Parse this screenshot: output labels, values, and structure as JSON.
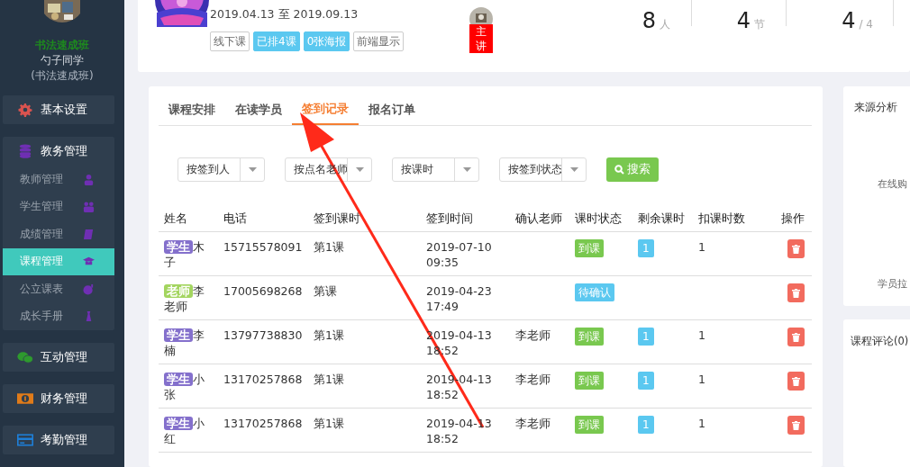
{
  "sidebar": {
    "class_name": "书法速成班",
    "user_name": "勺子同学",
    "user_class": "(书法速成班)",
    "menus": [
      {
        "label": "基本设置"
      },
      {
        "label": "教务管理",
        "children": [
          {
            "label": "教师管理",
            "selected": false
          },
          {
            "label": "学生管理",
            "selected": false
          },
          {
            "label": "成绩管理",
            "selected": false
          },
          {
            "label": "课程管理",
            "selected": true
          },
          {
            "label": "公立课表",
            "selected": false
          },
          {
            "label": "成长手册",
            "selected": false
          }
        ]
      },
      {
        "label": "互动管理"
      },
      {
        "label": "财务管理"
      },
      {
        "label": "考勤管理"
      }
    ]
  },
  "course": {
    "dates": "2019.04.13 至 2019.09.13",
    "tags": [
      {
        "label": "线下课",
        "kind": "outline"
      },
      {
        "label": "已排4课",
        "kind": "filled"
      },
      {
        "label": "0张海报",
        "kind": "filled"
      },
      {
        "label": "前端显示",
        "kind": "outline"
      }
    ],
    "teacher_badge": "主讲",
    "stats": [
      {
        "value": "8",
        "unit": "人"
      },
      {
        "value": "4",
        "unit": "节"
      },
      {
        "value": "4",
        "unit": "/ 4"
      }
    ]
  },
  "tabs": [
    {
      "label": "课程安排",
      "selected": false
    },
    {
      "label": "在读学员",
      "selected": false
    },
    {
      "label": "签到记录",
      "selected": true
    },
    {
      "label": "报名订单",
      "selected": false
    }
  ],
  "filters": [
    "按签到人",
    "按点名老师",
    "按课时",
    "按签到状态"
  ],
  "search_button": "搜索",
  "table": {
    "columns": [
      "姓名",
      "电话",
      "签到课时",
      "签到时间",
      "确认老师",
      "课时状态",
      "剩余课时",
      "扣课时数",
      "操作"
    ],
    "rows": [
      {
        "tag": {
          "kind": "student",
          "label": "学生"
        },
        "name": "木子",
        "phone": "15715578091",
        "lesson": "第1课",
        "date": "2019-07-10",
        "time": "09:35",
        "teacher": "",
        "status": {
          "kind": "arrived",
          "label": "到课"
        },
        "remaining": "1",
        "deduct": "1"
      },
      {
        "tag": {
          "kind": "teacher",
          "label": "老师"
        },
        "name": "李老师",
        "phone": "17005698268",
        "lesson": "第课",
        "date": "2019-04-23",
        "time": "17:49",
        "teacher": "",
        "status": {
          "kind": "pending",
          "label": "待确认"
        },
        "remaining": "",
        "deduct": ""
      },
      {
        "tag": {
          "kind": "student",
          "label": "学生"
        },
        "name": "李楠",
        "phone": "13797738830",
        "lesson": "第1课",
        "date": "2019-04-13",
        "time": "18:52",
        "teacher": "李老师",
        "status": {
          "kind": "arrived",
          "label": "到课"
        },
        "remaining": "1",
        "deduct": "1"
      },
      {
        "tag": {
          "kind": "student",
          "label": "学生"
        },
        "name": "小张",
        "phone": "13170257868",
        "lesson": "第1课",
        "date": "2019-04-13",
        "time": "18:52",
        "teacher": "李老师",
        "status": {
          "kind": "arrived",
          "label": "到课"
        },
        "remaining": "1",
        "deduct": "1"
      },
      {
        "tag": {
          "kind": "student",
          "label": "学生"
        },
        "name": "小红",
        "phone": "13170257868",
        "lesson": "第1课",
        "date": "2019-04-13",
        "time": "18:52",
        "teacher": "李老师",
        "status": {
          "kind": "arrived",
          "label": "到课"
        },
        "remaining": "1",
        "deduct": "1"
      }
    ]
  },
  "source_panel": {
    "title": "来源分析",
    "labels": [
      "在线购",
      "学员拉"
    ]
  },
  "comments_panel": {
    "title": "课程评论(0)"
  }
}
